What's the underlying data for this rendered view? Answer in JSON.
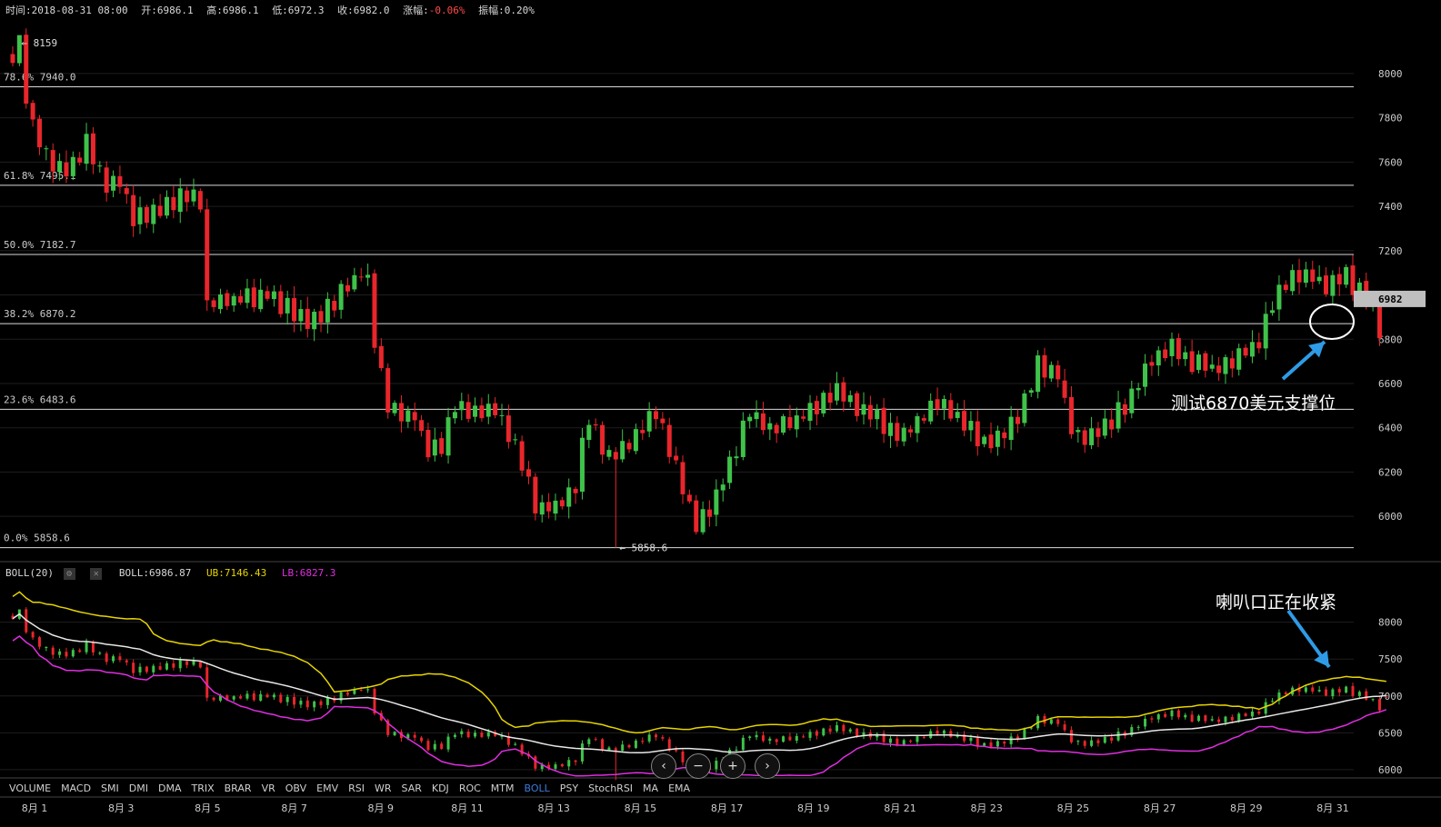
{
  "info": {
    "time": "时间:2018-08-31 08:00",
    "open": "开:6986.1",
    "high": "高:6986.1",
    "low": "低:6972.3",
    "close": "收:6982.0",
    "change_label": "涨幅:",
    "change_value": "-0.06%",
    "amplitude": "振幅:0.20%"
  },
  "boll_header": {
    "name": "BOLL(20)",
    "mid": "BOLL:6986.87",
    "ub": "UB:7146.43",
    "lb": "LB:6827.3"
  },
  "indicators": [
    "VOLUME",
    "MACD",
    "SMI",
    "DMI",
    "DMA",
    "TRIX",
    "BRAR",
    "VR",
    "OBV",
    "EMV",
    "RSI",
    "WR",
    "SAR",
    "KDJ",
    "ROC",
    "MTM",
    "BOLL",
    "PSY",
    "StochRSI",
    "MA",
    "EMA"
  ],
  "active_indicator": "BOLL",
  "x_labels": [
    "8月 1",
    "8月 3",
    "8月 5",
    "8月 7",
    "8月 9",
    "8月 11",
    "8月 13",
    "8月 15",
    "8月 17",
    "8月 19",
    "8月 21",
    "8月 23",
    "8月 25",
    "8月 27",
    "8月 29",
    "8月 31"
  ],
  "nav_buttons": [
    "‹",
    "−",
    "+",
    "›"
  ],
  "annotations": {
    "support": "测试6870美元支撑位",
    "squeeze": "喇叭口正在收紧"
  },
  "colors": {
    "up": "#3fc24a",
    "down": "#e8262b",
    "ub": "#e6d400",
    "lb": "#e02ee0",
    "mid": "#e8e8e8",
    "grid": "#1e1e1e",
    "fib": "#d9d9d9",
    "arrow": "#2f9be6",
    "price_tag_bg": "#bfbfbf"
  },
  "chart_data": [
    {
      "type": "candlestick",
      "title": "",
      "timeframe_note": "8月 1 – 8月 31, 2018",
      "y_ticks": [
        6000,
        6200,
        6400,
        6600,
        6800,
        7000,
        7200,
        7400,
        7600,
        7800,
        8000
      ],
      "ylim": [
        5820,
        8250
      ],
      "current_price": "6982",
      "high_marker": "← 8159",
      "low_marker": "← 5858.6",
      "fib_levels": [
        {
          "label": "78.6% 7940.0",
          "value": 7940.0
        },
        {
          "label": "61.8% 7495.1",
          "value": 7495.1
        },
        {
          "label": "50.0% 7182.7",
          "value": 7182.7
        },
        {
          "label": "38.2% 6870.2",
          "value": 6870.2
        },
        {
          "label": "23.6% 6483.6",
          "value": 6483.6
        },
        {
          "label": "0.0% 5858.6",
          "value": 5858.6
        }
      ],
      "anchors": [
        [
          0,
          8080
        ],
        [
          1,
          8150
        ],
        [
          2,
          7910
        ],
        [
          3,
          7750
        ],
        [
          5,
          7630
        ],
        [
          8,
          7560
        ],
        [
          11,
          7680
        ],
        [
          14,
          7480
        ],
        [
          16,
          7520
        ],
        [
          18,
          7330
        ],
        [
          21,
          7380
        ],
        [
          25,
          7450
        ],
        [
          28,
          7430
        ],
        [
          29,
          6960
        ],
        [
          33,
          6980
        ],
        [
          38,
          7000
        ],
        [
          42,
          6920
        ],
        [
          45,
          6880
        ],
        [
          49,
          7000
        ],
        [
          52,
          7110
        ],
        [
          53,
          7050
        ],
        [
          54,
          6790
        ],
        [
          56,
          6490
        ],
        [
          60,
          6450
        ],
        [
          62,
          6290
        ],
        [
          64,
          6330
        ],
        [
          66,
          6520
        ],
        [
          69,
          6460
        ],
        [
          72,
          6490
        ],
        [
          75,
          6330
        ],
        [
          78,
          6030
        ],
        [
          82,
          6060
        ],
        [
          84,
          6150
        ],
        [
          86,
          6460
        ],
        [
          89,
          6260
        ],
        [
          92,
          6330
        ],
        [
          96,
          6480
        ],
        [
          99,
          6230
        ],
        [
          102,
          5960
        ],
        [
          104,
          6040
        ],
        [
          107,
          6230
        ],
        [
          110,
          6480
        ],
        [
          113,
          6380
        ],
        [
          116,
          6420
        ],
        [
          119,
          6480
        ],
        [
          123,
          6560
        ],
        [
          126,
          6500
        ],
        [
          129,
          6440
        ],
        [
          132,
          6360
        ],
        [
          135,
          6420
        ],
        [
          138,
          6520
        ],
        [
          142,
          6430
        ],
        [
          145,
          6320
        ],
        [
          147,
          6370
        ],
        [
          150,
          6460
        ],
        [
          153,
          6690
        ],
        [
          156,
          6640
        ],
        [
          158,
          6400
        ],
        [
          160,
          6340
        ],
        [
          163,
          6400
        ],
        [
          166,
          6500
        ],
        [
          168,
          6600
        ],
        [
          170,
          6700
        ],
        [
          173,
          6760
        ],
        [
          176,
          6700
        ],
        [
          179,
          6660
        ],
        [
          182,
          6700
        ],
        [
          184,
          6750
        ],
        [
          186,
          6780
        ],
        [
          188,
          6950
        ],
        [
          190,
          7050
        ],
        [
          193,
          7100
        ],
        [
          196,
          7040
        ],
        [
          199,
          7080
        ],
        [
          202,
          6980
        ],
        [
          204,
          6850
        ],
        [
          205,
          6982
        ]
      ]
    },
    {
      "type": "line",
      "name": "BOLL(20)",
      "y_ticks": [
        6000,
        6500,
        7000,
        7500,
        8000
      ],
      "ylim": [
        5900,
        8550
      ],
      "series_names": [
        "UB",
        "BOLL",
        "LB"
      ]
    }
  ]
}
